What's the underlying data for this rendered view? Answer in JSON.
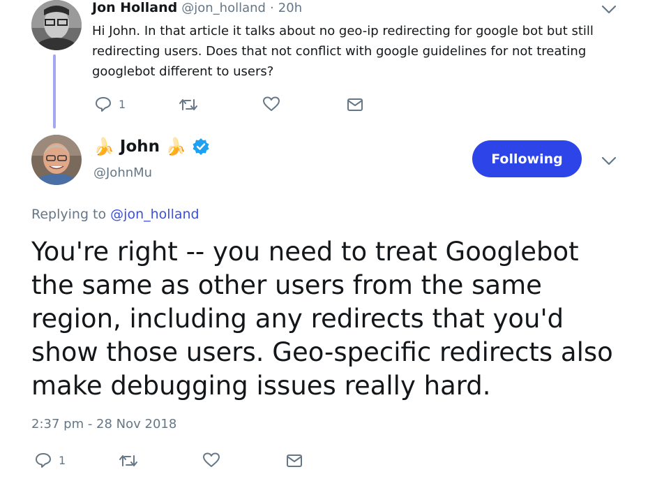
{
  "parent_tweet": {
    "author_name": "Jon Holland",
    "author_handle": "@jon_holland",
    "separator": "·",
    "time_ago": "20h",
    "text": "Hi John. In that article it talks about no geo-ip redirecting for google bot but still redirecting users. Does that not conflict with google guidelines for not treating googlebot different to users?",
    "reply_count": "1"
  },
  "main_tweet": {
    "author_name": "John",
    "author_emoji": "🍌",
    "author_handle": "@JohnMu",
    "follow_label": "Following",
    "replying_prefix": "Replying to",
    "replying_handle": "@jon_holland",
    "text": "You're right -- you need to treat Googlebot the same as other users from the same region, including any redirects that you'd show those users. Geo-specific redirects also make debugging issues really hard.",
    "timestamp": "2:37 pm - 28 Nov 2018",
    "reply_count": "1"
  },
  "colors": {
    "accent": "#2d45e8",
    "muted": "#657786",
    "thread_line": "#a3a8f0",
    "verified": "#1da1f2"
  }
}
